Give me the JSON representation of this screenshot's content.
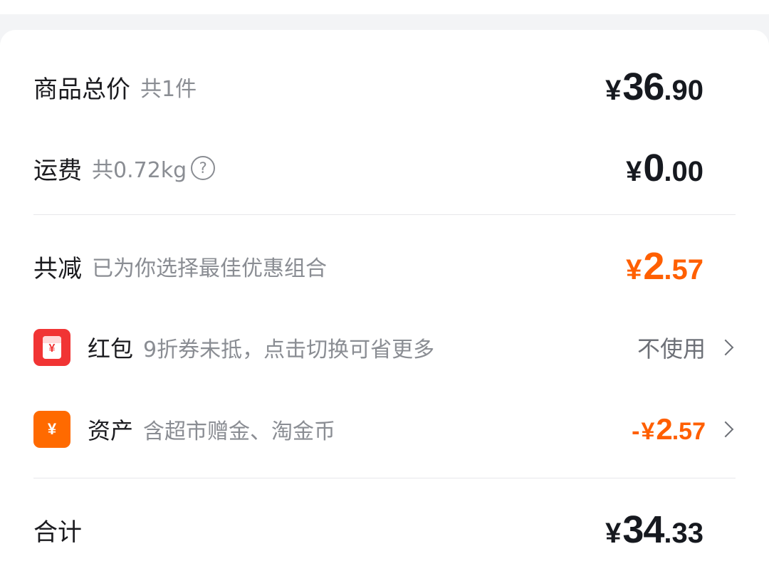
{
  "summary": {
    "goods_total": {
      "label": "商品总价",
      "sub": "共1件",
      "currency": "¥",
      "int": "36",
      "dec": ".90"
    },
    "shipping": {
      "label": "运费",
      "sub": "共0.72kg",
      "help_icon": "?",
      "currency": "¥",
      "int": "0",
      "dec": ".00"
    },
    "discount": {
      "label": "共减",
      "sub": "已为你选择最佳优惠组合",
      "currency": "¥",
      "int": "2",
      "dec": ".57",
      "color": "#ff5f00"
    },
    "red_packet": {
      "icon": "red-envelope-icon",
      "icon_glyph": "¥",
      "label": "红包",
      "sub": "9折券未抵，点击切换可省更多",
      "action": "不使用"
    },
    "assets": {
      "icon": "yuan-icon",
      "icon_glyph": "¥",
      "label": "资产",
      "sub": "含超市赠金、淘金币",
      "sign": "-",
      "currency": "¥",
      "int": "2",
      "dec": ".57",
      "color": "#ff5f00"
    },
    "total": {
      "label": "合计",
      "currency": "¥",
      "int": "34",
      "dec": ".33"
    }
  },
  "colors": {
    "accent": "#ff5f00",
    "red_badge": "#f13434",
    "orange_badge": "#ff6a00"
  }
}
